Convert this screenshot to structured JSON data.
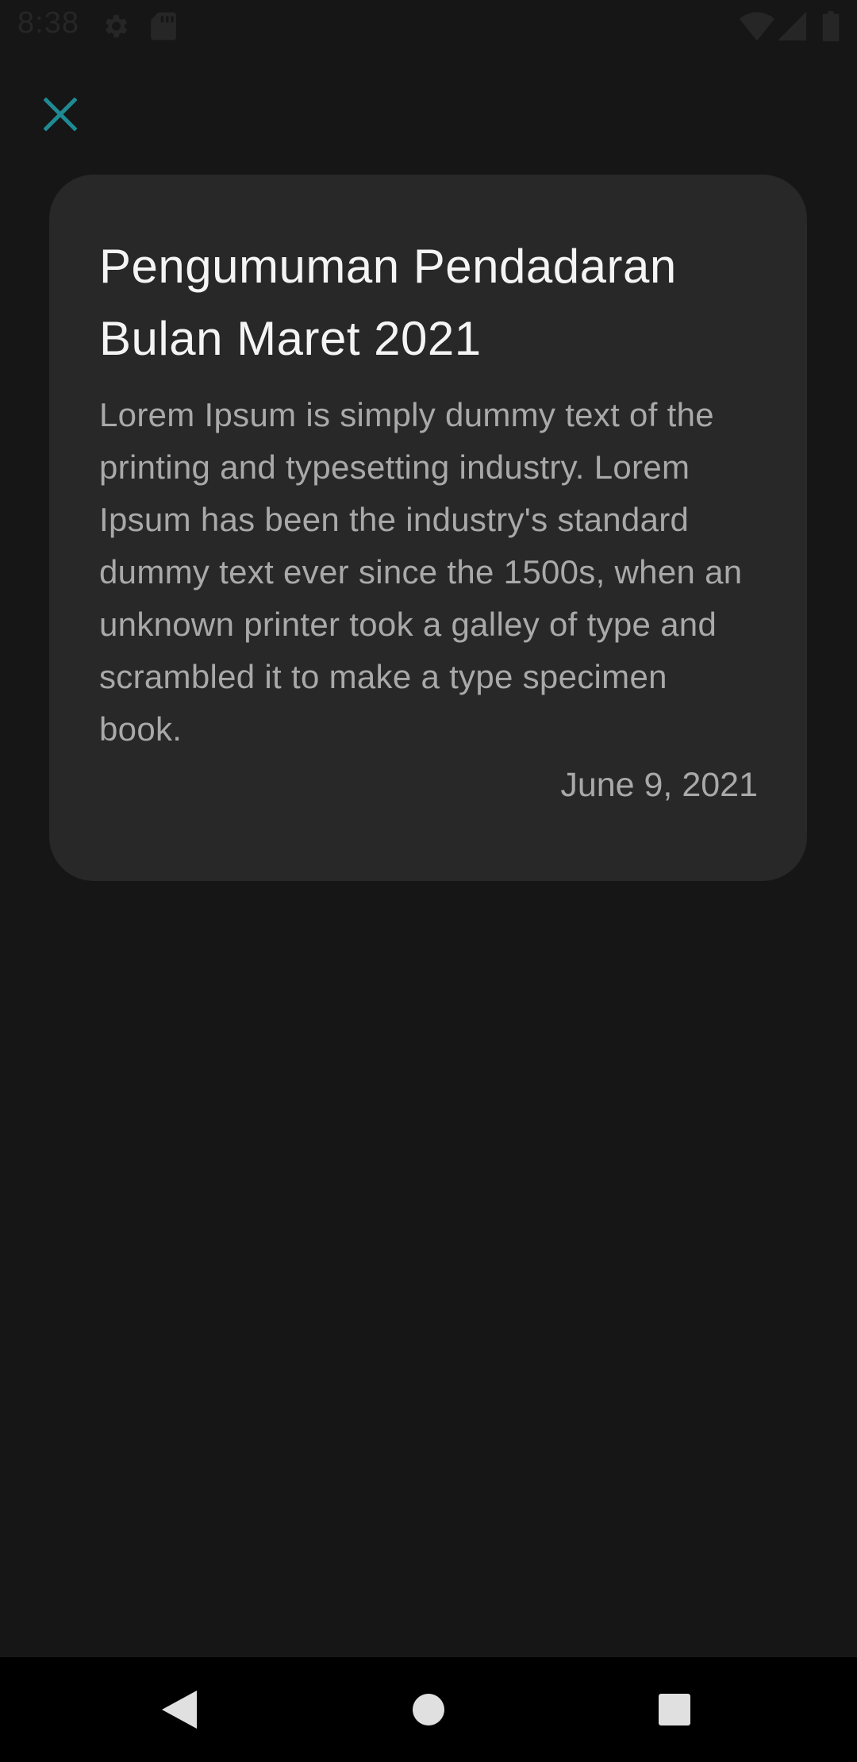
{
  "status_bar": {
    "time": "8:38",
    "left_icons": [
      "gear-icon",
      "sd-card-icon"
    ],
    "right_icons": [
      "wifi-icon",
      "cell-signal-icon",
      "battery-icon"
    ]
  },
  "toolbar": {
    "close_icon": "close-icon",
    "accent_color": "#1e8a94"
  },
  "announcement": {
    "title": "Pengumuman Pendadaran Bulan Maret 2021",
    "body": "Lorem Ipsum is simply dummy text of the printing and typesetting industry. Lorem Ipsum has been the industry's standard dummy text ever since the 1500s, when an unknown printer took a galley of type and scrambled it to make a type specimen book.",
    "date": "June 9, 2021"
  },
  "colors": {
    "background": "#161616",
    "card": "#282828",
    "title_text": "#f4f4f4",
    "body_text": "#a9a9a9"
  },
  "nav_bar": {
    "buttons": [
      "back-icon",
      "home-icon",
      "recents-icon"
    ]
  }
}
